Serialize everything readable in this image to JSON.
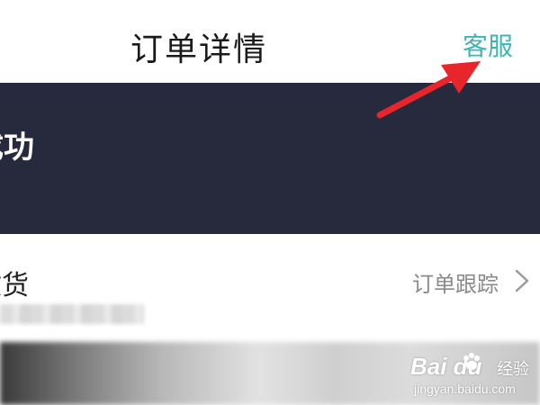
{
  "header": {
    "title": "订单详情",
    "service_label": "客服"
  },
  "status_banner": {
    "text": "成功",
    "background": "#262a3c"
  },
  "receipt": {
    "status_text": "收货",
    "tracking_label": "订单跟踪"
  },
  "colors": {
    "accent": "#3fb5b0",
    "annotation_arrow": "#e8252b"
  },
  "icons": {
    "chevron": "chevron-right-icon",
    "arrow": "red-arrow-annotation"
  },
  "watermark": {
    "logo": "Bai du",
    "product": "经验",
    "url": "jingyan.baidu.com"
  }
}
